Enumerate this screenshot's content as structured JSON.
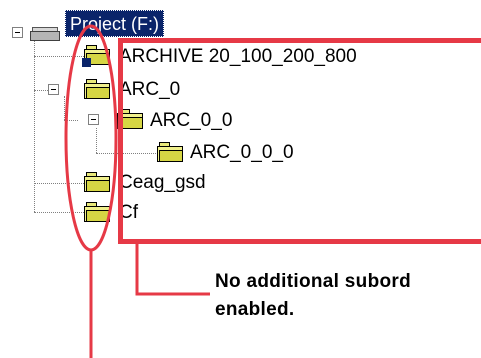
{
  "tree": {
    "root": {
      "label": "Project (F:)",
      "icon": "drive-icon"
    },
    "items": [
      {
        "label": "ARCHIVE 20_100_200_800",
        "icon": "folder-icon"
      },
      {
        "label": "ARC_0",
        "icon": "folder-icon"
      },
      {
        "label": "ARC_0_0",
        "icon": "folder-icon"
      },
      {
        "label": "ARC_0_0_0",
        "icon": "folder-icon"
      },
      {
        "label": "Ceag_gsd",
        "icon": "folder-icon"
      },
      {
        "label": "Cf",
        "icon": "folder-icon"
      }
    ]
  },
  "annotation": {
    "line1": "No additional subord",
    "line2": "enabled."
  },
  "colors": {
    "callout": "#e63946",
    "selection": "#0a246a",
    "folder": "#f0f08c"
  }
}
